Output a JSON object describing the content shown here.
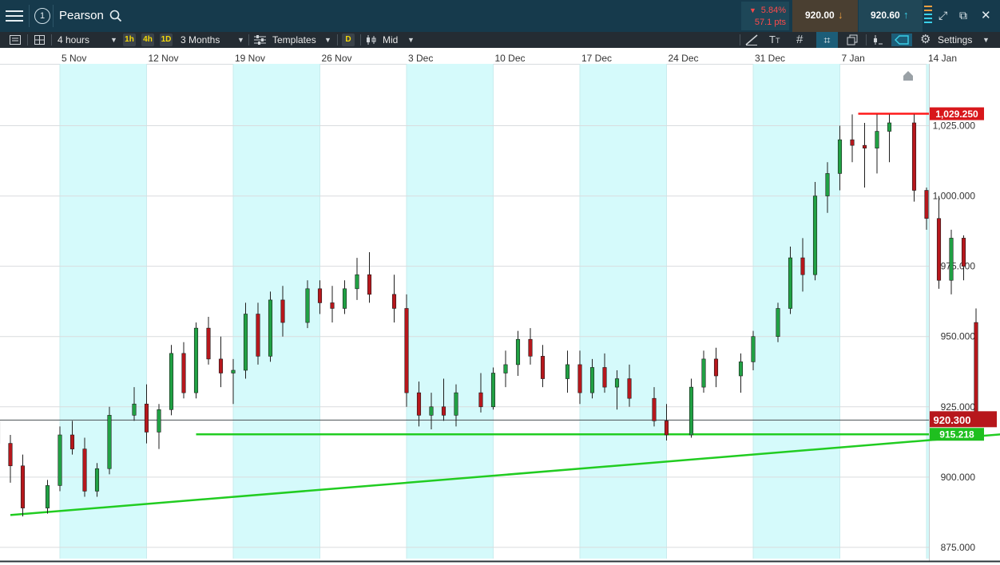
{
  "header": {
    "instrument": "Pearson",
    "alert_count": "1",
    "change_percent": "5.84%",
    "change_points": "57.1 pts",
    "sell_price": "920.00",
    "buy_price": "920.60"
  },
  "toolbar": {
    "interval": "4 hours",
    "quick_intervals": [
      "1h",
      "4h",
      "1D"
    ],
    "range": "3 Months",
    "templates_label": "Templates",
    "d_label": "D",
    "price_type": "Mid",
    "settings_label": "Settings"
  },
  "colors": {
    "up": "#21a144",
    "down": "#b7171c",
    "band": "#d5fafb",
    "trendline": "#21cc21",
    "resistance": "#ff1a1a",
    "header_bg": "#163a4c",
    "toolbar_bg": "#242c33"
  },
  "chart_data": {
    "type": "candlestick",
    "title": "Pearson",
    "interval": "4 hours",
    "range": "3 Months",
    "x_ticks": [
      "5 Nov",
      "12 Nov",
      "19 Nov",
      "26 Nov",
      "3 Dec",
      "10 Dec",
      "17 Dec",
      "24 Dec",
      "31 Dec",
      "7 Jan",
      "14 Jan"
    ],
    "y_ticks": [
      875,
      900,
      925,
      950,
      975,
      1000,
      1025
    ],
    "y_tick_labels": [
      "875.000",
      "900.000",
      "925.000",
      "950.000",
      "975.000",
      "1,000.000",
      "1,025.000"
    ],
    "ylim": [
      871,
      1047
    ],
    "current_price": 920.3,
    "current_price_label": "920.300",
    "resistance_level": 1029.25,
    "resistance_label": "1,029.250",
    "support_level": 915.218,
    "support_label": "915.218",
    "support_start": "16 Nov",
    "resistance_start": "9 Jan",
    "rising_trendline": {
      "from": {
        "date": "1 Nov",
        "value": 886.5
      },
      "to": {
        "date": "20 Jan",
        "value": 915.2
      }
    },
    "candles": [
      {
        "date": "31 Oct",
        "o": 920,
        "h": 928,
        "l": 908,
        "c": 912
      },
      {
        "date": "1 Nov",
        "o": 912,
        "h": 915,
        "l": 898,
        "c": 904
      },
      {
        "date": "2 Nov",
        "o": 904,
        "h": 908,
        "l": 886,
        "c": 889
      },
      {
        "date": "4 Nov",
        "o": 889,
        "h": 899,
        "l": 887,
        "c": 897
      },
      {
        "date": "5 Nov",
        "o": 897,
        "h": 918,
        "l": 895,
        "c": 915
      },
      {
        "date": "6 Nov",
        "o": 915,
        "h": 920,
        "l": 908,
        "c": 910
      },
      {
        "date": "7 Nov",
        "o": 910,
        "h": 914,
        "l": 893,
        "c": 895
      },
      {
        "date": "8 Nov",
        "o": 895,
        "h": 905,
        "l": 893,
        "c": 903
      },
      {
        "date": "9 Nov",
        "o": 903,
        "h": 925,
        "l": 901,
        "c": 922
      },
      {
        "date": "11 Nov",
        "o": 922,
        "h": 932,
        "l": 920,
        "c": 926
      },
      {
        "date": "12 Nov",
        "o": 926,
        "h": 933,
        "l": 912,
        "c": 916
      },
      {
        "date": "13 Nov",
        "o": 916,
        "h": 926,
        "l": 910,
        "c": 924
      },
      {
        "date": "14 Nov",
        "o": 924,
        "h": 947,
        "l": 922,
        "c": 944
      },
      {
        "date": "15 Nov",
        "o": 944,
        "h": 948,
        "l": 928,
        "c": 930
      },
      {
        "date": "16 Nov",
        "o": 930,
        "h": 955,
        "l": 928,
        "c": 953
      },
      {
        "date": "17 Nov",
        "o": 953,
        "h": 957,
        "l": 940,
        "c": 942
      },
      {
        "date": "18 Nov",
        "o": 942,
        "h": 950,
        "l": 932,
        "c": 937
      },
      {
        "date": "19 Nov",
        "o": 937,
        "h": 942,
        "l": 926,
        "c": 938
      },
      {
        "date": "20 Nov",
        "o": 938,
        "h": 962,
        "l": 935,
        "c": 958
      },
      {
        "date": "21 Nov",
        "o": 958,
        "h": 962,
        "l": 940,
        "c": 943
      },
      {
        "date": "22 Nov",
        "o": 943,
        "h": 966,
        "l": 941,
        "c": 963
      },
      {
        "date": "23 Nov",
        "o": 963,
        "h": 968,
        "l": 950,
        "c": 955
      },
      {
        "date": "25 Nov",
        "o": 955,
        "h": 970,
        "l": 953,
        "c": 967
      },
      {
        "date": "26 Nov",
        "o": 967,
        "h": 970,
        "l": 958,
        "c": 962
      },
      {
        "date": "27 Nov",
        "o": 962,
        "h": 968,
        "l": 955,
        "c": 960
      },
      {
        "date": "28 Nov",
        "o": 960,
        "h": 970,
        "l": 958,
        "c": 967
      },
      {
        "date": "29 Nov",
        "o": 967,
        "h": 978,
        "l": 963,
        "c": 972
      },
      {
        "date": "30 Nov",
        "o": 972,
        "h": 980,
        "l": 962,
        "c": 965
      },
      {
        "date": "2 Dec",
        "o": 965,
        "h": 972,
        "l": 955,
        "c": 960
      },
      {
        "date": "3 Dec",
        "o": 960,
        "h": 965,
        "l": 925,
        "c": 930
      },
      {
        "date": "4 Dec",
        "o": 930,
        "h": 934,
        "l": 918,
        "c": 922
      },
      {
        "date": "5 Dec",
        "o": 922,
        "h": 930,
        "l": 917,
        "c": 925
      },
      {
        "date": "6 Dec",
        "o": 925,
        "h": 935,
        "l": 920,
        "c": 922
      },
      {
        "date": "7 Dec",
        "o": 922,
        "h": 933,
        "l": 918,
        "c": 930
      },
      {
        "date": "9 Dec",
        "o": 930,
        "h": 937,
        "l": 923,
        "c": 925
      },
      {
        "date": "10 Dec",
        "o": 925,
        "h": 939,
        "l": 924,
        "c": 937
      },
      {
        "date": "11 Dec",
        "o": 937,
        "h": 945,
        "l": 932,
        "c": 940
      },
      {
        "date": "12 Dec",
        "o": 940,
        "h": 952,
        "l": 936,
        "c": 949
      },
      {
        "date": "13 Dec",
        "o": 949,
        "h": 953,
        "l": 940,
        "c": 943
      },
      {
        "date": "14 Dec",
        "o": 943,
        "h": 947,
        "l": 932,
        "c": 935
      },
      {
        "date": "16 Dec",
        "o": 935,
        "h": 945,
        "l": 930,
        "c": 940
      },
      {
        "date": "17 Dec",
        "o": 940,
        "h": 945,
        "l": 926,
        "c": 930
      },
      {
        "date": "18 Dec",
        "o": 930,
        "h": 942,
        "l": 928,
        "c": 939
      },
      {
        "date": "19 Dec",
        "o": 939,
        "h": 944,
        "l": 930,
        "c": 932
      },
      {
        "date": "20 Dec",
        "o": 932,
        "h": 938,
        "l": 924,
        "c": 935
      },
      {
        "date": "21 Dec",
        "o": 935,
        "h": 940,
        "l": 925,
        "c": 928
      },
      {
        "date": "23 Dec",
        "o": 928,
        "h": 932,
        "l": 918,
        "c": 920
      },
      {
        "date": "24 Dec",
        "o": 920,
        "h": 926,
        "l": 913,
        "c": 915
      },
      {
        "date": "26 Dec",
        "o": 915,
        "h": 935,
        "l": 914,
        "c": 932
      },
      {
        "date": "27 Dec",
        "o": 932,
        "h": 945,
        "l": 930,
        "c": 942
      },
      {
        "date": "28 Dec",
        "o": 942,
        "h": 946,
        "l": 932,
        "c": 936
      },
      {
        "date": "30 Dec",
        "o": 936,
        "h": 944,
        "l": 930,
        "c": 941
      },
      {
        "date": "31 Dec",
        "o": 941,
        "h": 952,
        "l": 938,
        "c": 950
      },
      {
        "date": "2 Jan",
        "o": 950,
        "h": 962,
        "l": 948,
        "c": 960
      },
      {
        "date": "3 Jan",
        "o": 960,
        "h": 982,
        "l": 958,
        "c": 978
      },
      {
        "date": "4 Jan",
        "o": 978,
        "h": 985,
        "l": 966,
        "c": 972
      },
      {
        "date": "5 Jan",
        "o": 972,
        "h": 1005,
        "l": 970,
        "c": 1000
      },
      {
        "date": "6 Jan",
        "o": 1000,
        "h": 1012,
        "l": 994,
        "c": 1008
      },
      {
        "date": "7 Jan",
        "o": 1008,
        "h": 1025,
        "l": 1002,
        "c": 1020
      },
      {
        "date": "8 Jan",
        "o": 1020,
        "h": 1029,
        "l": 1012,
        "c": 1018
      },
      {
        "date": "9 Jan",
        "o": 1018,
        "h": 1026,
        "l": 1003,
        "c": 1017
      },
      {
        "date": "10 Jan",
        "o": 1017,
        "h": 1029,
        "l": 1008,
        "c": 1023
      },
      {
        "date": "11 Jan",
        "o": 1023,
        "h": 1029,
        "l": 1012,
        "c": 1026
      },
      {
        "date": "13 Jan",
        "o": 1026,
        "h": 1029,
        "l": 998,
        "c": 1002
      },
      {
        "date": "14 Jan",
        "o": 1002,
        "h": 1003,
        "l": 988,
        "c": 992
      },
      {
        "date": "15 Jan",
        "o": 992,
        "h": 1000,
        "l": 967,
        "c": 970
      },
      {
        "date": "16 Jan",
        "o": 970,
        "h": 988,
        "l": 965,
        "c": 985
      },
      {
        "date": "17 Jan",
        "o": 985,
        "h": 986,
        "l": 970,
        "c": 975
      },
      {
        "date": "18 Jan",
        "o": 955,
        "h": 960,
        "l": 920,
        "c": 922
      }
    ]
  }
}
